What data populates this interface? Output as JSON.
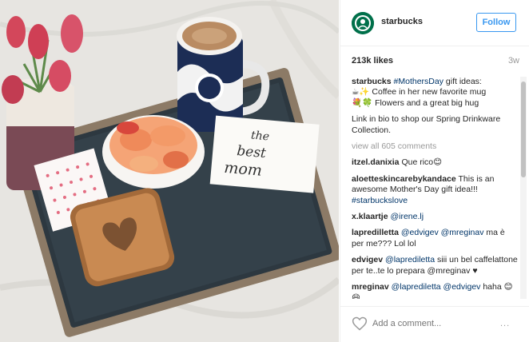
{
  "post": {
    "username": "starbucks",
    "follow_label": "Follow",
    "likes": "213k likes",
    "age": "3w"
  },
  "photo": {
    "card_text": [
      "the",
      "best",
      "mom"
    ]
  },
  "caption": {
    "user": "starbucks",
    "hashtag": "#MothersDay",
    "text1": "gift ideas:",
    "line2": "☕✨ Coffee in her new favorite mug",
    "line3": "💐🍀 Flowers and a great big hug",
    "line4": "Link in bio to shop our Spring Drinkware Collection."
  },
  "view_all": "view all 605 comments",
  "comments": [
    {
      "user": "itzel.danixia",
      "text": "Que rico😊",
      "tag": "",
      "rest": ""
    },
    {
      "user": "aloetteskincarebykandace",
      "text": "This is an awesome Mother's Day gift idea!!!",
      "tag": "#starbuckslove",
      "rest": ""
    },
    {
      "user": "x.klaartje",
      "text": "",
      "tag": "@irene.lj",
      "rest": ""
    },
    {
      "user": "lapredilletta",
      "text": "",
      "tag": "@edvigev @mreginav",
      "rest": "ma è per me??? Lol lol"
    },
    {
      "user": "edvigev",
      "text": "",
      "tag": "@laprediletta",
      "rest": "siii un bel caffelattone per te..te lo prepara @mreginav ♥"
    },
    {
      "user": "mreginav",
      "text": "",
      "tag": "@laprediletta @edvigev",
      "rest": "haha 😊😄"
    }
  ],
  "footer": {
    "placeholder": "Add a comment...",
    "more": "..."
  },
  "colors": {
    "accent": "#3897f0",
    "starbucks_green": "#00704a",
    "link": "#003569"
  }
}
